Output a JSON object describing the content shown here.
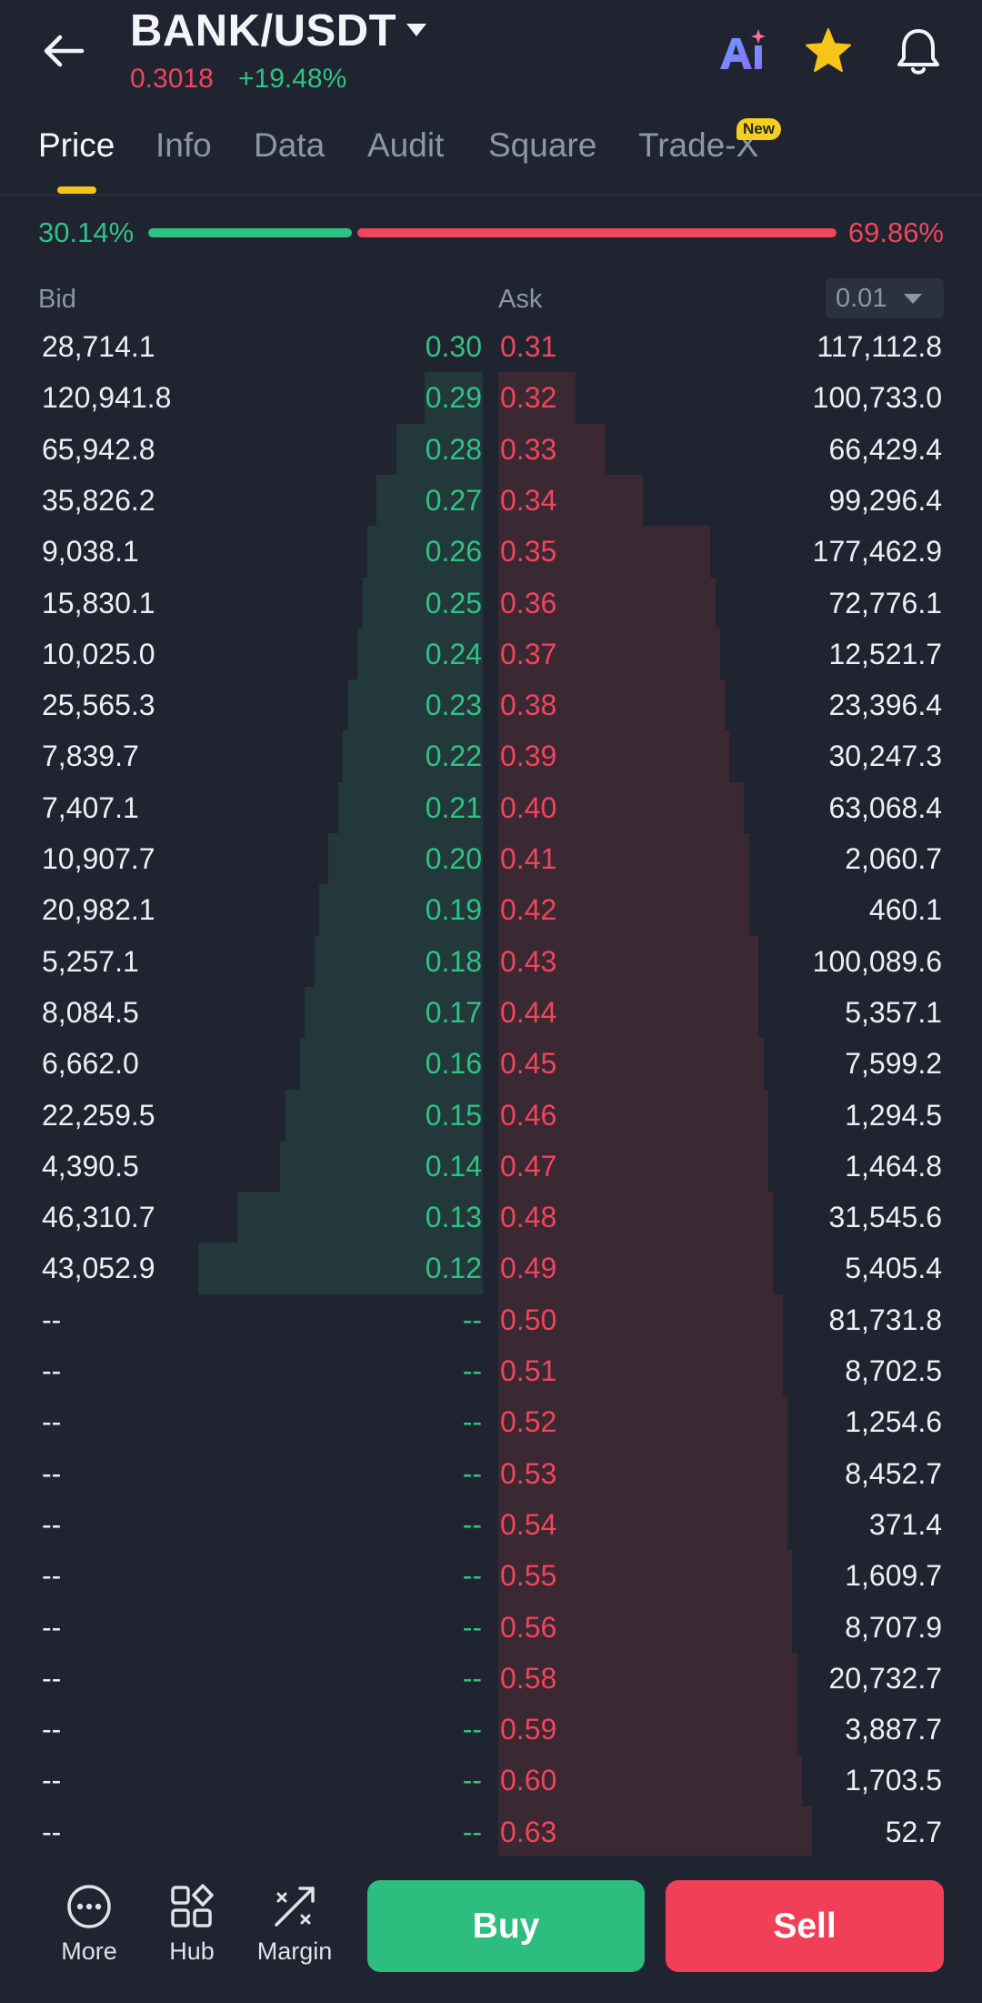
{
  "header": {
    "pair": "BANK/USDT",
    "price": "0.3018",
    "change": "+19.48%"
  },
  "tabs": [
    {
      "label": "Price",
      "active": true
    },
    {
      "label": "Info"
    },
    {
      "label": "Data"
    },
    {
      "label": "Audit"
    },
    {
      "label": "Square"
    },
    {
      "label": "Trade-X",
      "badge": "New"
    }
  ],
  "ratio": {
    "buy_label": "30.14%",
    "sell_label": "69.86%",
    "buy": 30.14,
    "sell": 69.86
  },
  "columns": {
    "bid": "Bid",
    "ask": "Ask",
    "precision": "0.01"
  },
  "colors": {
    "buy": "#2fc383",
    "sell": "#f0455b",
    "accent": "#f3c21b"
  },
  "orderbook": {
    "rows": [
      {
        "bid_qty": "28,714.1",
        "bid_price": "0.30",
        "ask_price": "0.31",
        "ask_qty": "117,112.8"
      },
      {
        "bid_qty": "120,941.8",
        "bid_price": "0.29",
        "ask_price": "0.32",
        "ask_qty": "100,733.0"
      },
      {
        "bid_qty": "65,942.8",
        "bid_price": "0.28",
        "ask_price": "0.33",
        "ask_qty": "66,429.4"
      },
      {
        "bid_qty": "35,826.2",
        "bid_price": "0.27",
        "ask_price": "0.34",
        "ask_qty": "99,296.4"
      },
      {
        "bid_qty": "9,038.1",
        "bid_price": "0.26",
        "ask_price": "0.35",
        "ask_qty": "177,462.9"
      },
      {
        "bid_qty": "15,830.1",
        "bid_price": "0.25",
        "ask_price": "0.36",
        "ask_qty": "72,776.1"
      },
      {
        "bid_qty": "10,025.0",
        "bid_price": "0.24",
        "ask_price": "0.37",
        "ask_qty": "12,521.7"
      },
      {
        "bid_qty": "25,565.3",
        "bid_price": "0.23",
        "ask_price": "0.38",
        "ask_qty": "23,396.4"
      },
      {
        "bid_qty": "7,839.7",
        "bid_price": "0.22",
        "ask_price": "0.39",
        "ask_qty": "30,247.3"
      },
      {
        "bid_qty": "7,407.1",
        "bid_price": "0.21",
        "ask_price": "0.40",
        "ask_qty": "63,068.4"
      },
      {
        "bid_qty": "10,907.7",
        "bid_price": "0.20",
        "ask_price": "0.41",
        "ask_qty": "2,060.7"
      },
      {
        "bid_qty": "20,982.1",
        "bid_price": "0.19",
        "ask_price": "0.42",
        "ask_qty": "460.1"
      },
      {
        "bid_qty": "5,257.1",
        "bid_price": "0.18",
        "ask_price": "0.43",
        "ask_qty": "100,089.6"
      },
      {
        "bid_qty": "8,084.5",
        "bid_price": "0.17",
        "ask_price": "0.44",
        "ask_qty": "5,357.1"
      },
      {
        "bid_qty": "6,662.0",
        "bid_price": "0.16",
        "ask_price": "0.45",
        "ask_qty": "7,599.2"
      },
      {
        "bid_qty": "22,259.5",
        "bid_price": "0.15",
        "ask_price": "0.46",
        "ask_qty": "1,294.5"
      },
      {
        "bid_qty": "4,390.5",
        "bid_price": "0.14",
        "ask_price": "0.47",
        "ask_qty": "1,464.8"
      },
      {
        "bid_qty": "46,310.7",
        "bid_price": "0.13",
        "ask_price": "0.48",
        "ask_qty": "31,545.6"
      },
      {
        "bid_qty": "43,052.9",
        "bid_price": "0.12",
        "ask_price": "0.49",
        "ask_qty": "5,405.4"
      },
      {
        "bid_qty": "--",
        "bid_price": "--",
        "ask_price": "0.50",
        "ask_qty": "81,731.8"
      },
      {
        "bid_qty": "--",
        "bid_price": "--",
        "ask_price": "0.51",
        "ask_qty": "8,702.5"
      },
      {
        "bid_qty": "--",
        "bid_price": "--",
        "ask_price": "0.52",
        "ask_qty": "1,254.6"
      },
      {
        "bid_qty": "--",
        "bid_price": "--",
        "ask_price": "0.53",
        "ask_qty": "8,452.7"
      },
      {
        "bid_qty": "--",
        "bid_price": "--",
        "ask_price": "0.54",
        "ask_qty": "371.4"
      },
      {
        "bid_qty": "--",
        "bid_price": "--",
        "ask_price": "0.55",
        "ask_qty": "1,609.7"
      },
      {
        "bid_qty": "--",
        "bid_price": "--",
        "ask_price": "0.56",
        "ask_qty": "8,707.9"
      },
      {
        "bid_qty": "--",
        "bid_price": "--",
        "ask_price": "0.58",
        "ask_qty": "20,732.7"
      },
      {
        "bid_qty": "--",
        "bid_price": "--",
        "ask_price": "0.59",
        "ask_qty": "3,887.7"
      },
      {
        "bid_qty": "--",
        "bid_price": "--",
        "ask_price": "0.60",
        "ask_qty": "1,703.5"
      },
      {
        "bid_qty": "--",
        "bid_price": "--",
        "ask_price": "0.63",
        "ask_qty": "52.7"
      }
    ],
    "bid_depth_fraction": [
      0.0,
      0.12,
      0.18,
      0.22,
      0.24,
      0.25,
      0.26,
      0.28,
      0.29,
      0.3,
      0.32,
      0.34,
      0.35,
      0.37,
      0.38,
      0.41,
      0.42,
      0.51,
      0.59
    ],
    "ask_depth_fraction": [
      0.0,
      0.16,
      0.22,
      0.3,
      0.44,
      0.45,
      0.46,
      0.47,
      0.48,
      0.51,
      0.52,
      0.52,
      0.54,
      0.54,
      0.55,
      0.56,
      0.56,
      0.57,
      0.57,
      0.59,
      0.59,
      0.6,
      0.6,
      0.6,
      0.61,
      0.61,
      0.62,
      0.62,
      0.63,
      0.65
    ]
  },
  "bottom_nav": [
    {
      "label": "More",
      "icon": "more-icon"
    },
    {
      "label": "Hub",
      "icon": "hub-icon"
    },
    {
      "label": "Margin",
      "icon": "margin-icon"
    }
  ],
  "actions": {
    "buy": "Buy",
    "sell": "Sell"
  }
}
